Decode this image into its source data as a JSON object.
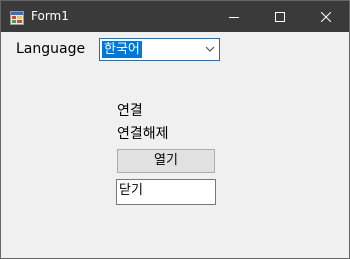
{
  "window": {
    "title": "Form1",
    "icon": "app-icon",
    "controls": {
      "minimize_icon": "minimize-icon",
      "maximize_icon": "maximize-icon",
      "close_icon": "close-icon"
    }
  },
  "form": {
    "language_label": "Language",
    "language_combo": {
      "selected": "한국어",
      "dropdown_icon": "chevron-down-icon"
    },
    "connect_label": "연결",
    "disconnect_label": "연결해제",
    "open_button": "열기",
    "close_field_value": "닫기"
  },
  "colors": {
    "titlebar": "#3a3a3a",
    "window_bg": "#f0f0f0",
    "selection": "#0078d7",
    "button_bg": "#e1e1e1"
  }
}
